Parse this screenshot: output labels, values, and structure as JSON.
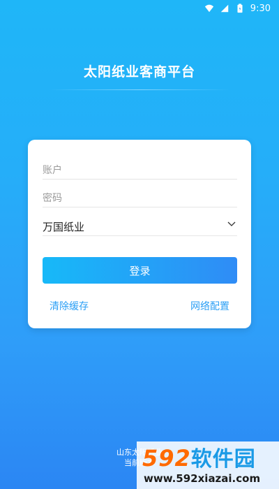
{
  "status_bar": {
    "time": "9:30"
  },
  "header": {
    "title": "太阳纸业客商平台"
  },
  "form": {
    "account_placeholder": "账户",
    "password_placeholder": "密码",
    "company_selected": "万国纸业",
    "login_label": "登录",
    "clear_cache_label": "清除缓存",
    "network_config_label": "网络配置"
  },
  "footer": {
    "line1": "山东太阳纸业",
    "line2": "当前版本"
  },
  "watermark": {
    "brand_num": "592",
    "brand_cn": "软件园",
    "url": "www.592xiazai.com"
  },
  "colors": {
    "accent": "#2b9ff5",
    "bg_top": "#1fb6f8",
    "bg_bottom": "#2b86f3",
    "watermark_orange": "#ff6a00"
  },
  "icons": [
    "wifi-icon",
    "signal-icon",
    "battery-icon",
    "chevron-down-icon"
  ]
}
